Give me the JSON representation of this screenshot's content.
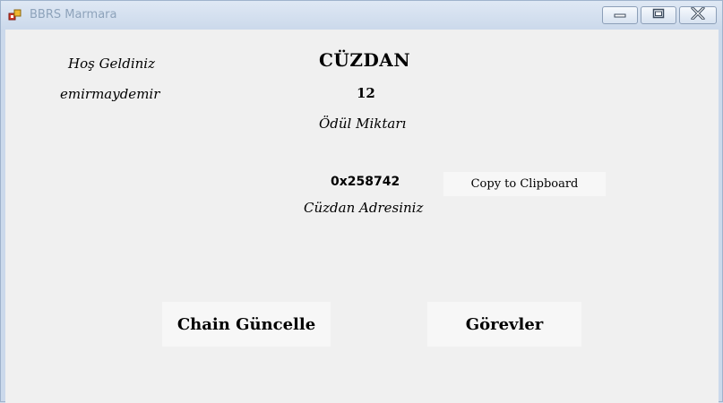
{
  "window": {
    "title": "BBRS Marmara"
  },
  "main": {
    "welcome_label": "Hoş Geldiniz",
    "username": "emirmaydemir",
    "wallet_title": "CÜZDAN",
    "reward_amount": "12",
    "reward_label": "Ödül Miktarı",
    "wallet_address": "0x258742",
    "wallet_address_label": "Cüzdan Adresiniz",
    "copy_button_label": "Copy to Clipboard",
    "chain_update_button_label": "Chain Güncelle",
    "tasks_button_label": "Görevler"
  }
}
